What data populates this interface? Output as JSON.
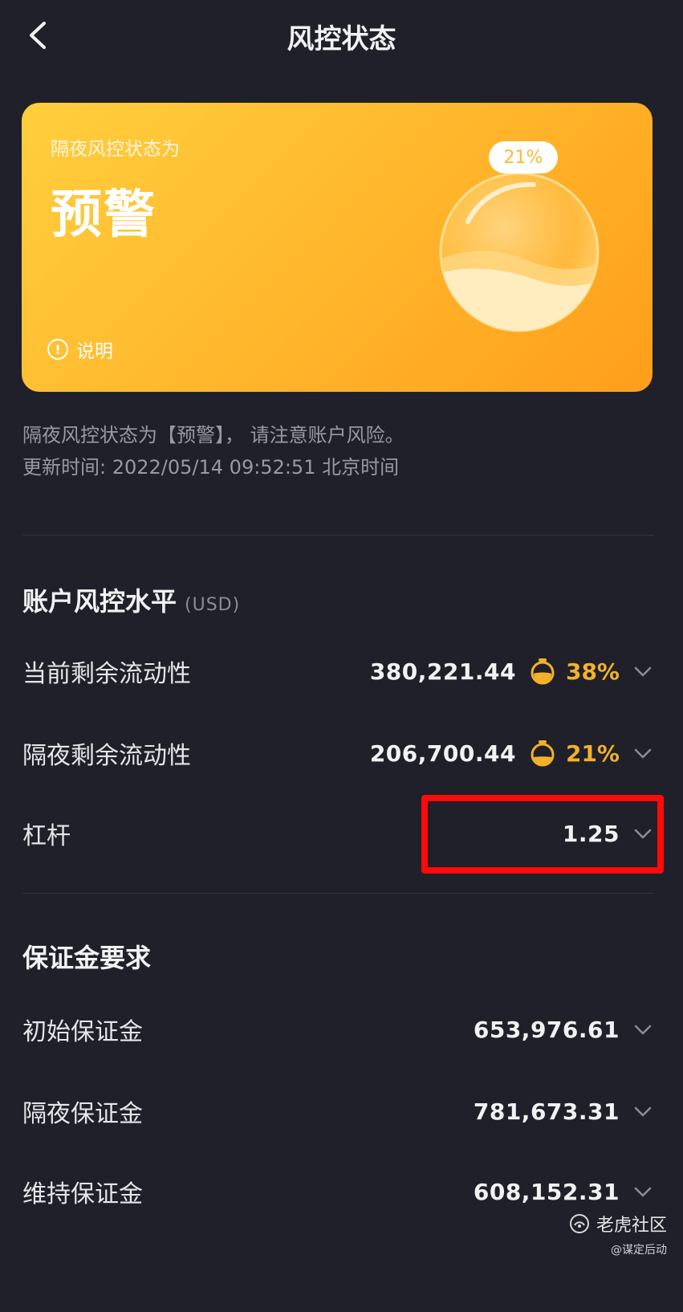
{
  "header": {
    "title": "风控状态",
    "back_icon": "chevron-left-icon"
  },
  "card": {
    "caption": "隔夜风控状态为",
    "status": "预警",
    "explain_label": "说明",
    "percent_badge": "21%",
    "fill_fraction": 0.21,
    "colors": {
      "gradient_start": "#ffcf3e",
      "gradient_end": "#ff9e1b"
    }
  },
  "description": {
    "line1": "隔夜风控状态为【预警】， 请注意账户风险。",
    "line2": "更新时间: 2022/05/14 09:52:51 北京时间"
  },
  "risk_section": {
    "title": "账户风控水平",
    "unit": "(USD)",
    "rows": [
      {
        "label": "当前剩余流动性",
        "value": "380,221.44",
        "percent": "38%"
      },
      {
        "label": "隔夜剩余流动性",
        "value": "206,700.44",
        "percent": "21%"
      },
      {
        "label": "杠杆",
        "value": "1.25"
      }
    ]
  },
  "margin_section": {
    "title": "保证金要求",
    "rows": [
      {
        "label": "初始保证金",
        "value": "653,976.61"
      },
      {
        "label": "隔夜保证金",
        "value": "781,673.31"
      },
      {
        "label": "维持保证金",
        "value": "608,152.31"
      }
    ]
  },
  "watermark": {
    "brand": "老虎社区",
    "user": "@谋定后动"
  },
  "accent_color": "#f3b12a",
  "highlight_color": "#ff0a0a"
}
